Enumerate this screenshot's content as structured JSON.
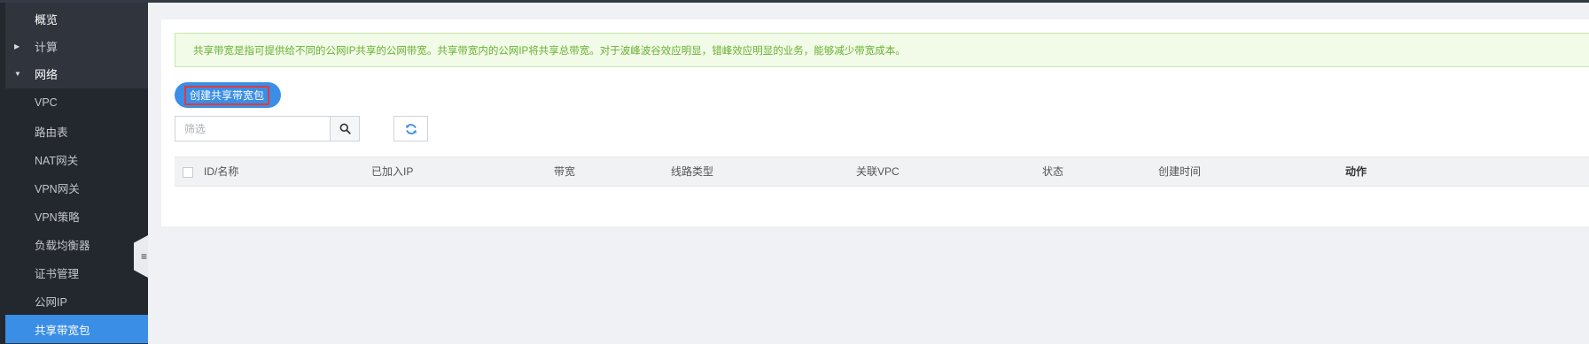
{
  "sidebar": {
    "overview": "概览",
    "compute": "计算",
    "network": "网络",
    "items": [
      "VPC",
      "路由表",
      "NAT网关",
      "VPN网关",
      "VPN策略",
      "负载均衡器",
      "证书管理",
      "公网IP",
      "共享带宽包"
    ],
    "active_index": 8
  },
  "notice": "共享带宽是指可提供给不同的公网IP共享的公网带宽。共享带宽内的公网IP将共享总带宽。对于波峰波谷效应明显，错峰效应明显的业务，能够减少带宽成本。",
  "toolbar": {
    "create_label": "创建共享带宽包",
    "filter_placeholder": "筛选",
    "search_icon": "search-icon",
    "refresh_icon": "refresh-icon"
  },
  "table": {
    "columns": [
      "ID/名称",
      "已加入IP",
      "带宽",
      "线路类型",
      "关联VPC",
      "状态",
      "创建时间",
      "动作"
    ]
  },
  "colors": {
    "accent": "#3a8ee6",
    "sidebar_bg": "#2f343d",
    "notice_text": "#67b231",
    "notice_bg": "#f2fae8"
  }
}
